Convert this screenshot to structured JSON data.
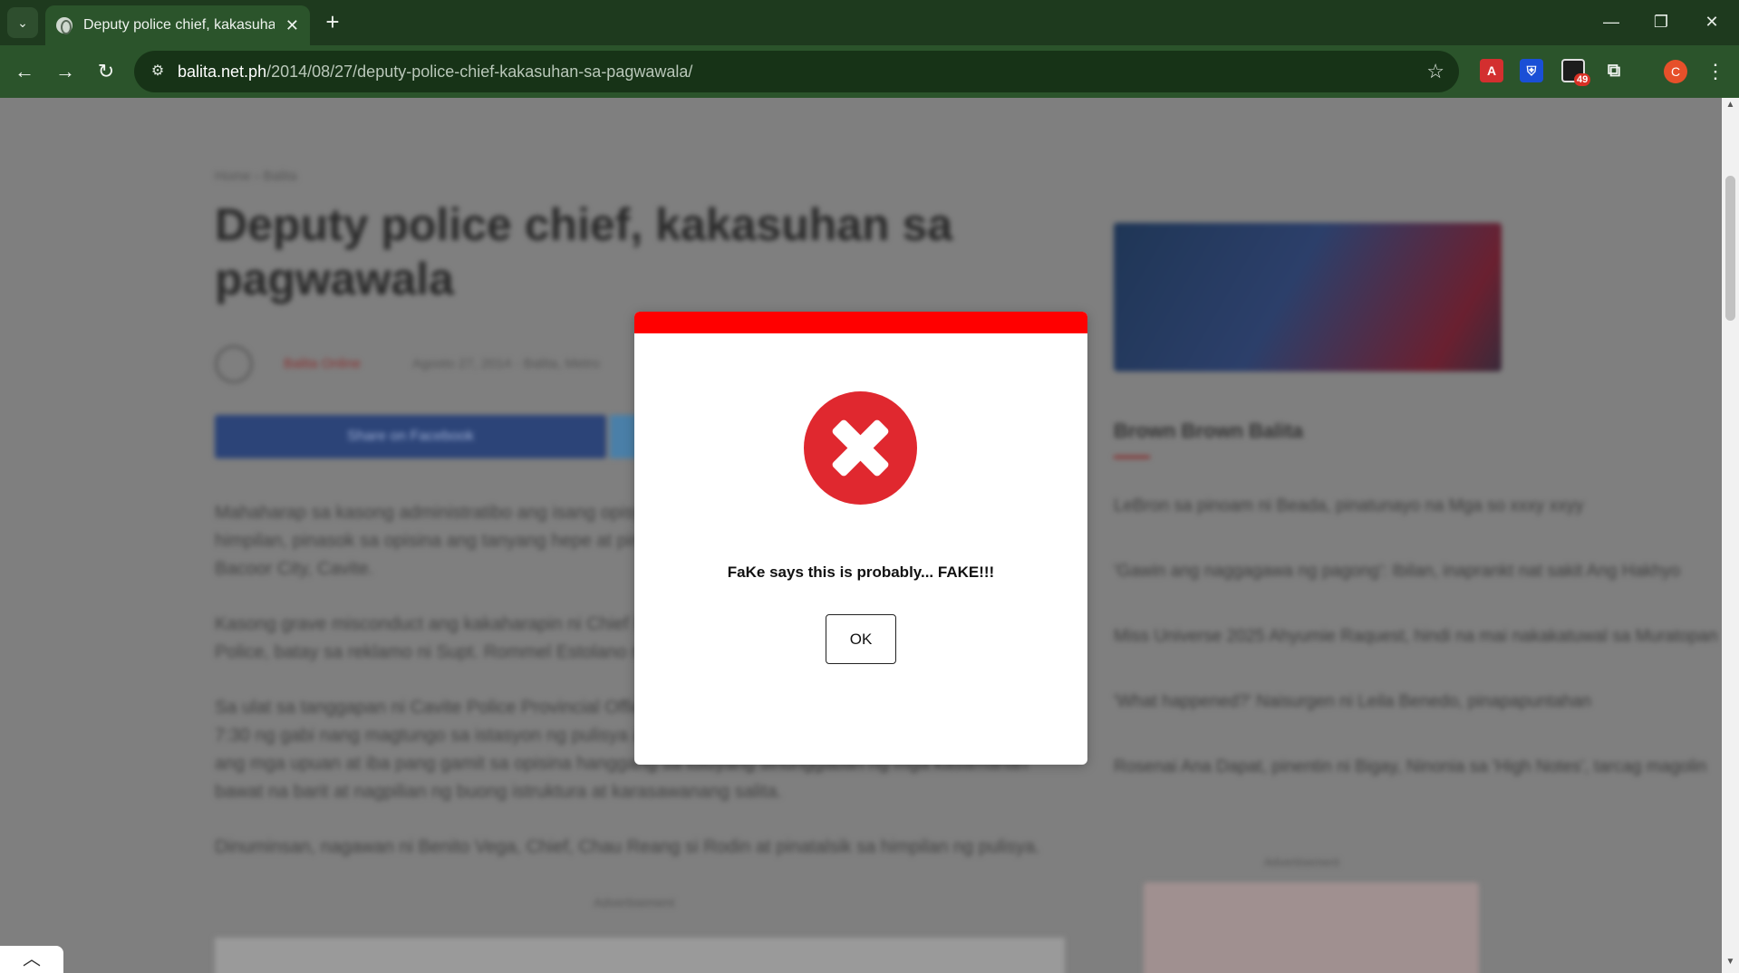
{
  "browser": {
    "tab": {
      "title": "Deputy police chief, kakasuhan"
    },
    "new_tab_symbol": "+",
    "window_controls": {
      "minimize": "—",
      "restore": "❐",
      "close": "✕"
    },
    "address": {
      "host": "balita.net.ph",
      "path": "/2014/08/27/deputy-police-chief-kakasuhan-sa-pagwawala/"
    },
    "extensions": [
      {
        "name": "pdf-extension-icon",
        "color": "#d32f2f"
      },
      {
        "name": "bitwarden-icon",
        "color": "#1a4fd6"
      },
      {
        "name": "badge-extension-icon",
        "badge": "49"
      },
      {
        "name": "puzzle-extensions-icon"
      }
    ],
    "profile_initial": "C"
  },
  "page": {
    "breadcrumb": "Home › Balita",
    "headline": "Deputy police chief, kakasuhan sa pagwawala",
    "author": "Balita Online",
    "meta": "Agosto 27, 2014 · Balita, Metro",
    "share_facebook": "Share on Facebook",
    "paragraphs": [
      "Mahaharap sa kasong administratibo ang isang opisyal ng pulisya matapos umano itong magwala sa",
      "himpilan, pinasok sa opisina ang tanyang hepe at pinagbantaan ang mga tauhan sa loob ng istasyon sa",
      "Bacoor City, Cavite.",
      "Kasong grave misconduct ang kakaharapin ni Chief Inspector na deputy chief ng Bacoor City",
      "Police, batay sa reklamo ni Supt. Rommel Estolano ng pulisya.",
      "Sa ulat sa tanggapan ni Cavite Police Provincial Office, dakong",
      "7:30 ng gabi nang magtungo sa istasyon ng pulisya ang suspek at nagsimulang magwala at pinasok",
      "ang mga upuan at iba pang gamit sa opisina hanggang sa tuluyang sinunggaban ng mga kasamahan",
      "bawat na barit at nagpilian ng buong istruktura at karasawanang salita.",
      "Dinuminsan, nagawan ni Benito Vega, Chief, Chau Reang si Rodin at pinatalsik sa himpilan ng pulisya."
    ],
    "advertisement_label": "Advertisement",
    "sidebar": {
      "heading": "Brown Brown Balita",
      "links": [
        "LeBron sa pinoam ni Beada, pinatunayo na Mga so xxxy xxyy",
        "'Gawin ang naggagawa ng pagong': Ibilan, inaprankt nat sakit Ang Hakhyo",
        "Miss Universe 2025 Ahyumie Raquest, hindi na mai nakakatuwal sa Muratopan",
        "'What happened?' Naisurgen ni Leila Benedo, pinapapuntahan",
        "Rosenai Ana Dapat, pinentin ni Bigay, Ninonia sa 'High Notes', tarcag magolin"
      ]
    }
  },
  "modal": {
    "icon": "error-x-icon",
    "message": "FaKe says this is probably... FAKE!!!",
    "ok_label": "OK",
    "accent_color": "#ff0000",
    "icon_color": "#e0282f"
  }
}
